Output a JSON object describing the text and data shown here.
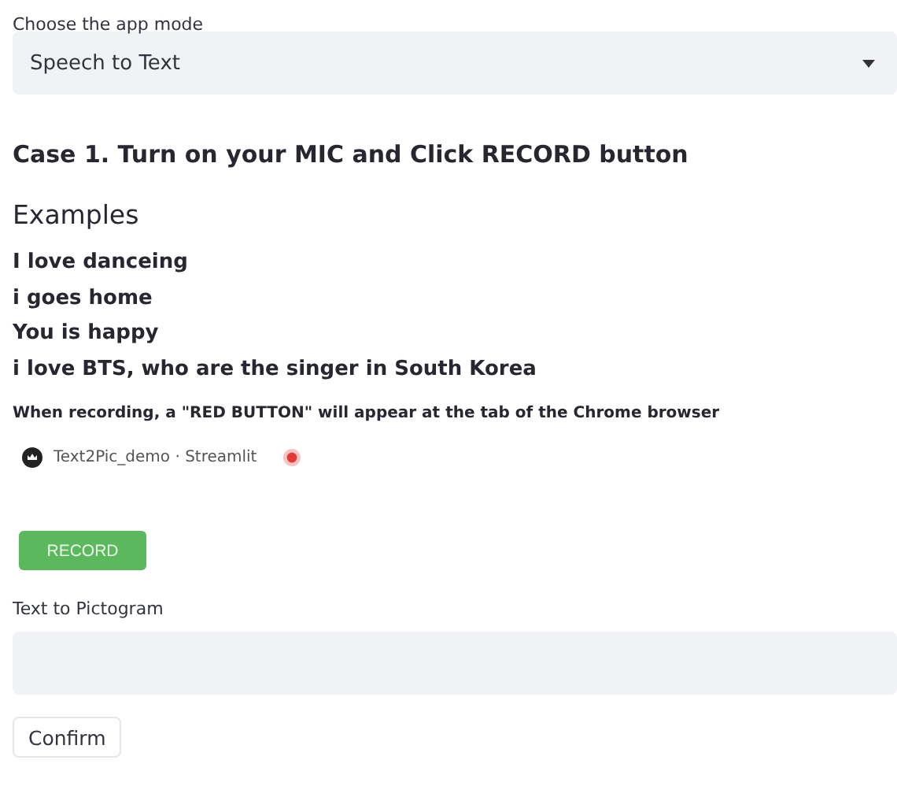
{
  "mode_select": {
    "label": "Choose the app mode",
    "value": "Speech to Text"
  },
  "heading": "Case 1. Turn on your MIC and Click RECORD button",
  "examples": {
    "title": "Examples",
    "items": [
      "I love danceing",
      "i goes home",
      "You is happy",
      "i love BTS, who are the singer in South Korea"
    ]
  },
  "note": "When recording, a \"RED BUTTON\" will appear at the tab of the Chrome browser",
  "browser_tab": {
    "title": "Text2Pic_demo · Streamlit",
    "recording": true
  },
  "record_button": "RECORD",
  "text_field": {
    "label": "Text to Pictogram"
  },
  "confirm_button": "Confirm"
}
